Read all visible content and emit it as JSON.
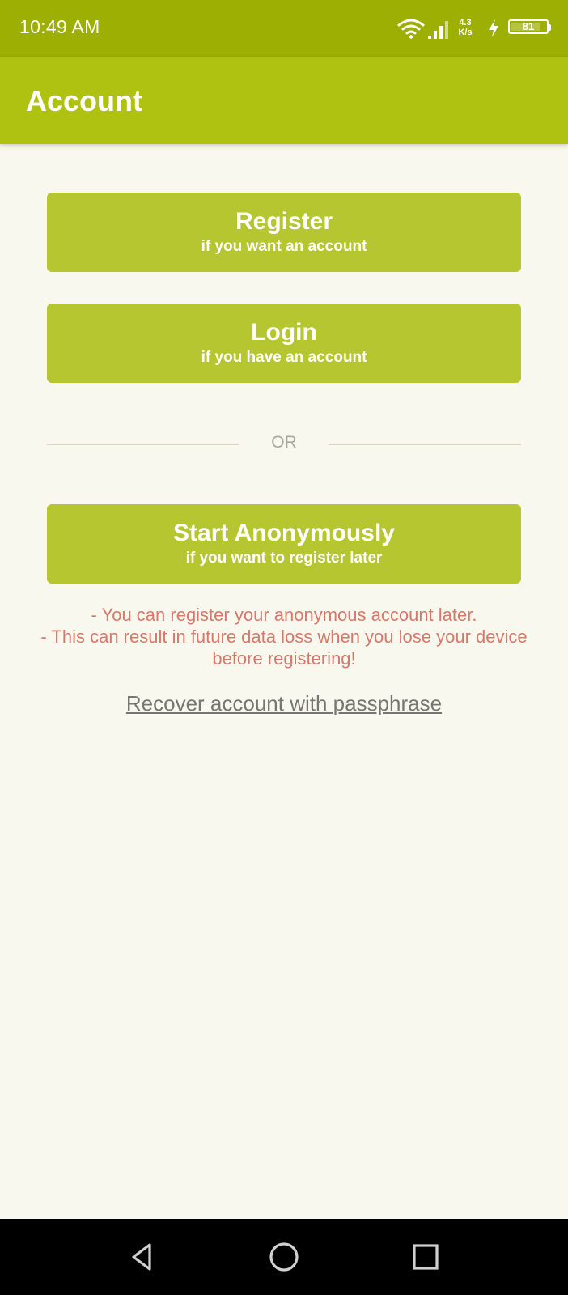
{
  "status_bar": {
    "time": "10:49 AM",
    "net_speed_value": "4.3",
    "net_speed_unit": "K/s",
    "battery_level": "81",
    "icons": [
      "wifi-icon",
      "signal-icon",
      "charging-bolt-icon",
      "battery-icon"
    ]
  },
  "app_bar": {
    "title": "Account"
  },
  "buttons": {
    "register": {
      "title": "Register",
      "subtitle": "if you want an account"
    },
    "login": {
      "title": "Login",
      "subtitle": "if you have an account"
    },
    "anonymous": {
      "title": "Start Anonymously",
      "subtitle": "if you want to register later"
    }
  },
  "divider": {
    "label": "OR"
  },
  "warning": {
    "line1": "- You can register your anonymous account later.",
    "line2": "- This can result in future data loss when you lose your device before registering!"
  },
  "recover": {
    "label": "Recover account with passphrase"
  },
  "nav_bar": {
    "icons": [
      "back-icon",
      "home-icon",
      "recents-icon"
    ]
  },
  "colors": {
    "status_bar": "#9caf02",
    "app_bar": "#afc211",
    "button": "#b6c631",
    "background": "#f9f8ee",
    "warning_text": "#d8786a",
    "link_text": "#777770"
  }
}
